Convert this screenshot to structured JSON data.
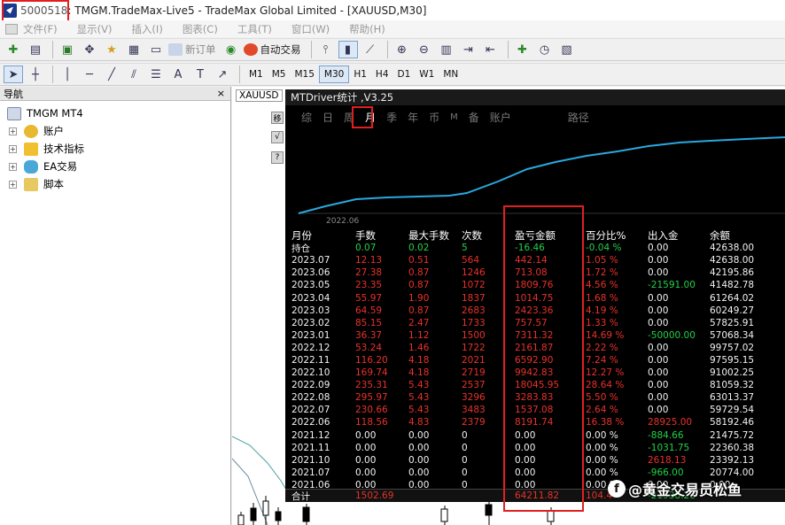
{
  "window": {
    "title_id": "5000518",
    "title_rest": ": TMGM.TradeMax-Live5 - TradeMax Global Limited - [XAUUSD,M30]"
  },
  "menu": [
    "文件(F)",
    "显示(V)",
    "插入(I)",
    "图表(C)",
    "工具(T)",
    "窗口(W)",
    "帮助(H)"
  ],
  "toolbar": {
    "new_order": "新订单",
    "auto_trading": "自动交易",
    "timeframes": [
      "M1",
      "M5",
      "M15",
      "M30",
      "H1",
      "H4",
      "D1",
      "W1",
      "MN"
    ],
    "selected_timeframe": "M30"
  },
  "navigator": {
    "title": "导航",
    "close": "×",
    "root": "TMGM MT4",
    "items": [
      "账户",
      "技术指标",
      "EA交易",
      "脚本"
    ]
  },
  "chart": {
    "symbol_label": "XAUUSD",
    "side_buttons": [
      "移",
      "√",
      "?"
    ]
  },
  "mtdriver": {
    "title": "MTDriver统计 ,V3.25",
    "tabs": [
      "综",
      "日",
      "周",
      "月",
      "季",
      "年",
      "币",
      "M",
      "备",
      "账户",
      "路径"
    ],
    "active_tab": "月",
    "equity_start_label": "2022.06",
    "headers": [
      "月份",
      "手数",
      "最大手数",
      "次数",
      "盈亏金额",
      "百分比%",
      "出入金",
      "余额"
    ],
    "rows": [
      {
        "month": "持仓",
        "lots": "0.07",
        "max_lots": "0.02",
        "count": "5",
        "pnl": "-16.46",
        "pct": "-0.04 %",
        "flow": "0.00",
        "balance": "42638.00",
        "color": "green",
        "flow_color": "white"
      },
      {
        "month": "2023.07",
        "lots": "12.13",
        "max_lots": "0.51",
        "count": "564",
        "pnl": "442.14",
        "pct": "1.05 %",
        "flow": "0.00",
        "balance": "42638.00",
        "color": "red",
        "flow_color": "white"
      },
      {
        "month": "2023.06",
        "lots": "27.38",
        "max_lots": "0.87",
        "count": "1246",
        "pnl": "713.08",
        "pct": "1.72 %",
        "flow": "0.00",
        "balance": "42195.86",
        "color": "red",
        "flow_color": "white"
      },
      {
        "month": "2023.05",
        "lots": "23.35",
        "max_lots": "0.87",
        "count": "1072",
        "pnl": "1809.76",
        "pct": "4.56 %",
        "flow": "-21591.00",
        "balance": "41482.78",
        "color": "red",
        "flow_color": "green"
      },
      {
        "month": "2023.04",
        "lots": "55.97",
        "max_lots": "1.90",
        "count": "1837",
        "pnl": "1014.75",
        "pct": "1.68 %",
        "flow": "0.00",
        "balance": "61264.02",
        "color": "red",
        "flow_color": "white"
      },
      {
        "month": "2023.03",
        "lots": "64.59",
        "max_lots": "0.87",
        "count": "2683",
        "pnl": "2423.36",
        "pct": "4.19 %",
        "flow": "0.00",
        "balance": "60249.27",
        "color": "red",
        "flow_color": "white"
      },
      {
        "month": "2023.02",
        "lots": "85.15",
        "max_lots": "2.47",
        "count": "1733",
        "pnl": "757.57",
        "pct": "1.33 %",
        "flow": "0.00",
        "balance": "57825.91",
        "color": "red",
        "flow_color": "white"
      },
      {
        "month": "2023.01",
        "lots": "36.37",
        "max_lots": "1.12",
        "count": "1500",
        "pnl": "7311.32",
        "pct": "14.69 %",
        "flow": "-50000.00",
        "balance": "57068.34",
        "color": "red",
        "flow_color": "green"
      },
      {
        "month": "2022.12",
        "lots": "53.24",
        "max_lots": "1.46",
        "count": "1722",
        "pnl": "2161.87",
        "pct": "2.22 %",
        "flow": "0.00",
        "balance": "99757.02",
        "color": "red",
        "flow_color": "white"
      },
      {
        "month": "2022.11",
        "lots": "116.20",
        "max_lots": "4.18",
        "count": "2021",
        "pnl": "6592.90",
        "pct": "7.24 %",
        "flow": "0.00",
        "balance": "97595.15",
        "color": "red",
        "flow_color": "white"
      },
      {
        "month": "2022.10",
        "lots": "169.74",
        "max_lots": "4.18",
        "count": "2719",
        "pnl": "9942.83",
        "pct": "12.27 %",
        "flow": "0.00",
        "balance": "91002.25",
        "color": "red",
        "flow_color": "white"
      },
      {
        "month": "2022.09",
        "lots": "235.31",
        "max_lots": "5.43",
        "count": "2537",
        "pnl": "18045.95",
        "pct": "28.64 %",
        "flow": "0.00",
        "balance": "81059.32",
        "color": "red",
        "flow_color": "white"
      },
      {
        "month": "2022.08",
        "lots": "295.97",
        "max_lots": "5.43",
        "count": "3296",
        "pnl": "3283.83",
        "pct": "5.50 %",
        "flow": "0.00",
        "balance": "63013.37",
        "color": "red",
        "flow_color": "white"
      },
      {
        "month": "2022.07",
        "lots": "230.66",
        "max_lots": "5.43",
        "count": "3483",
        "pnl": "1537.08",
        "pct": "2.64 %",
        "flow": "0.00",
        "balance": "59729.54",
        "color": "red",
        "flow_color": "white"
      },
      {
        "month": "2022.06",
        "lots": "118.56",
        "max_lots": "4.83",
        "count": "2379",
        "pnl": "8191.74",
        "pct": "16.38 %",
        "flow": "28925.00",
        "balance": "58192.46",
        "color": "red",
        "flow_color": "red"
      },
      {
        "month": "2021.12",
        "lots": "0.00",
        "max_lots": "0.00",
        "count": "0",
        "pnl": "0.00",
        "pct": "0.00 %",
        "flow": "-884.66",
        "balance": "21475.72",
        "color": "white",
        "flow_color": "green"
      },
      {
        "month": "2021.11",
        "lots": "0.00",
        "max_lots": "0.00",
        "count": "0",
        "pnl": "0.00",
        "pct": "0.00 %",
        "flow": "-1031.75",
        "balance": "22360.38",
        "color": "white",
        "flow_color": "green"
      },
      {
        "month": "2021.10",
        "lots": "0.00",
        "max_lots": "0.00",
        "count": "0",
        "pnl": "0.00",
        "pct": "0.00 %",
        "flow": "2618.13",
        "balance": "23392.13",
        "color": "white",
        "flow_color": "red"
      },
      {
        "month": "2021.07",
        "lots": "0.00",
        "max_lots": "0.00",
        "count": "0",
        "pnl": "0.00",
        "pct": "0.00 %",
        "flow": "-966.00",
        "balance": "20774.00",
        "color": "white",
        "flow_color": "green"
      },
      {
        "month": "2021.06",
        "lots": "0.00",
        "max_lots": "0.00",
        "count": "0",
        "pnl": "0.00",
        "pct": "0.00 %",
        "flow": "0.00",
        "balance": "0.00",
        "color": "white",
        "flow_color": "white"
      }
    ],
    "total": {
      "label": "合计",
      "lots": "1502.69",
      "pnl": "64211.82",
      "pct": "104.4",
      "flow": "-21938.28"
    }
  },
  "watermark": {
    "text": "@黄金交易员松鱼"
  },
  "colors": {
    "red": "#e8322a",
    "green": "#22d04a",
    "equity_line": "#29a8e0",
    "highlight": "#e02020"
  }
}
